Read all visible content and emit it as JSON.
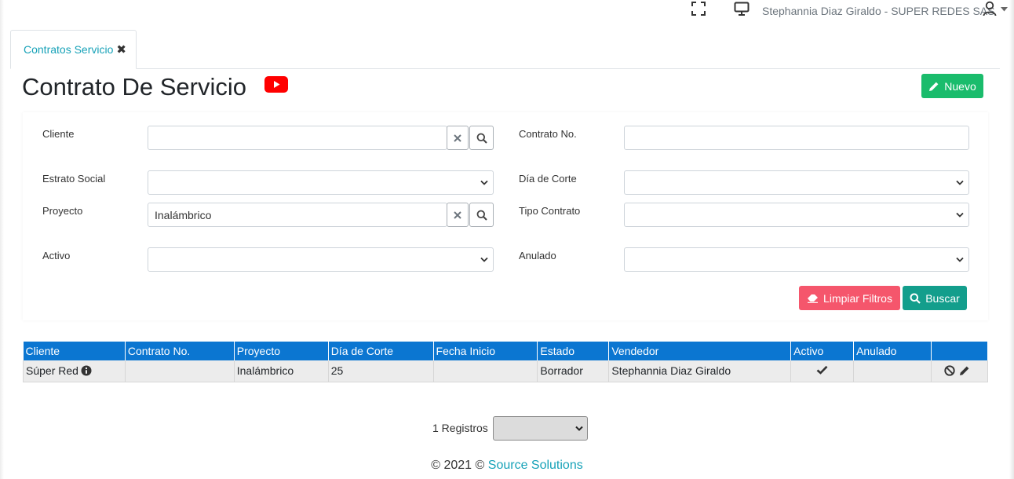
{
  "topbar": {
    "user_name": "Stephannia Diaz Giraldo - SUPER REDES SAS",
    "icons": [
      "fullscreen-icon",
      "monitor-icon",
      "user-icon",
      "caret-down-icon"
    ]
  },
  "tabs": [
    {
      "label": "Contratos Servicio",
      "close": "✖"
    }
  ],
  "header": {
    "title": "Contrato De Servicio",
    "new_button": "Nuevo",
    "video_icon": "youtube-icon"
  },
  "filters": {
    "cliente": {
      "label": "Cliente",
      "value": ""
    },
    "contrato_no": {
      "label": "Contrato No.",
      "value": ""
    },
    "estrato_social": {
      "label": "Estrato Social",
      "value": ""
    },
    "dia_corte": {
      "label": "Día de Corte",
      "value": ""
    },
    "proyecto": {
      "label": "Proyecto",
      "value": "Inalámbrico"
    },
    "tipo_contrato": {
      "label": "Tipo Contrato",
      "value": ""
    },
    "activo": {
      "label": "Activo",
      "value": ""
    },
    "anulado": {
      "label": "Anulado",
      "value": ""
    },
    "clear_button": "Limpiar Filtros",
    "search_button": "Buscar"
  },
  "table": {
    "columns": [
      "Cliente",
      "Contrato No.",
      "Proyecto",
      "Día de Corte",
      "Fecha Inicio",
      "Estado",
      "Vendedor",
      "Activo",
      "Anulado",
      ""
    ],
    "rows": [
      {
        "cliente": "Súper Red",
        "contrato_no": "",
        "proyecto": "Inalámbrico",
        "dia_corte": "25",
        "fecha_inicio": "",
        "estado": "Borrador",
        "vendedor": "Stephannia Diaz Giraldo",
        "activo": true,
        "anulado": false
      }
    ]
  },
  "pager": {
    "label": "1 Registros",
    "page_size": ""
  },
  "footer": {
    "prefix": "© 2021 ©",
    "link": "Source Solutions"
  },
  "colors": {
    "accent_teal": "#17a2b8",
    "new_green": "#1abc6c",
    "clear_red": "#f5566c",
    "search_teal": "#139e8c",
    "table_header": "#0b76d1",
    "youtube_red": "#ff0000"
  }
}
